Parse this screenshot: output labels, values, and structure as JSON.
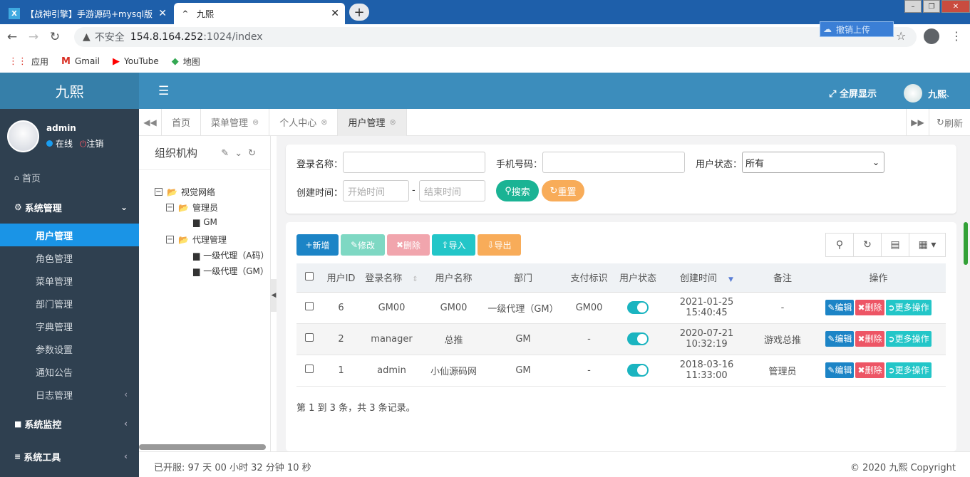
{
  "browser": {
    "tabs": [
      {
        "title": "【战神引擎】手游源码+mysql版",
        "favicon": "X",
        "active": false
      },
      {
        "title": "九熙",
        "favicon": "^",
        "active": true
      }
    ],
    "new_tab": "+",
    "url_warning": "不安全",
    "url_host": "154.8.164.252",
    "url_path": ":1024/index",
    "ext_badge": "撤销上传",
    "bookmarks": [
      "应用",
      "Gmail",
      "YouTube",
      "地图"
    ]
  },
  "app": {
    "logo": "九熙",
    "user": {
      "name": "admin",
      "status": "在线",
      "logout": "注销"
    },
    "fullscreen": "全屏显示",
    "top_user": "九熙"
  },
  "sidebar": {
    "home": "首页",
    "system": "系统管理",
    "items": [
      "用户管理",
      "角色管理",
      "菜单管理",
      "部门管理",
      "字典管理",
      "参数设置",
      "通知公告",
      "日志管理"
    ],
    "monitor": "系统监控",
    "tools": "系统工具"
  },
  "pagetabs": {
    "tabs": [
      "首页",
      "菜单管理",
      "个人中心",
      "用户管理"
    ],
    "refresh": "刷新"
  },
  "tree": {
    "title": "组织机构",
    "nodes": [
      "视觉网络",
      "管理员",
      "GM",
      "代理管理",
      "一级代理（A码）",
      "一级代理（GM）"
    ]
  },
  "search": {
    "login_label": "登录名称：",
    "phone_label": "手机号码：",
    "status_label": "用户状态：",
    "status_value": "所有",
    "created_label": "创建时间：",
    "start_placeholder": "开始时间",
    "end_placeholder": "结束时间",
    "dash": "-",
    "search_btn": "搜索",
    "reset_btn": "重置"
  },
  "toolbar": {
    "add": "新增",
    "edit": "修改",
    "delete": "删除",
    "import": "导入",
    "export": "导出"
  },
  "table": {
    "headers": [
      "用户ID",
      "登录名称",
      "用户名称",
      "部门",
      "支付标识",
      "用户状态",
      "创建时间",
      "备注",
      "操作"
    ],
    "rows": [
      {
        "id": "6",
        "login": "GM00",
        "name": "GM00",
        "dept": "一级代理（GM）",
        "pay": "GM00",
        "created": "2021-01-25 15:40:45",
        "remark": "-"
      },
      {
        "id": "2",
        "login": "manager",
        "name": "总推",
        "dept": "GM",
        "pay": "-",
        "created": "2020-07-21 10:32:19",
        "remark": "游戏总推"
      },
      {
        "id": "1",
        "login": "admin",
        "name": "小仙源码网",
        "dept": "GM",
        "pay": "-",
        "created": "2018-03-16 11:33:00",
        "remark": "管理员"
      }
    ],
    "action_edit": "编辑",
    "action_delete": "删除",
    "action_more": "更多操作",
    "pager": "第 1 到 3 条，共 3 条记录。"
  },
  "footer": {
    "uptime": "已开服: 97 天 00 小时 32 分钟 10 秒",
    "copyright": "© 2020 九熙 Copyright"
  },
  "colors": {
    "sidebar": "#2f4050",
    "topbar": "#3c8dbc",
    "active": "#1a94e6",
    "primary": "#1c84c6",
    "success": "#1ab394",
    "warning": "#f8ac59",
    "danger": "#ed5565"
  }
}
